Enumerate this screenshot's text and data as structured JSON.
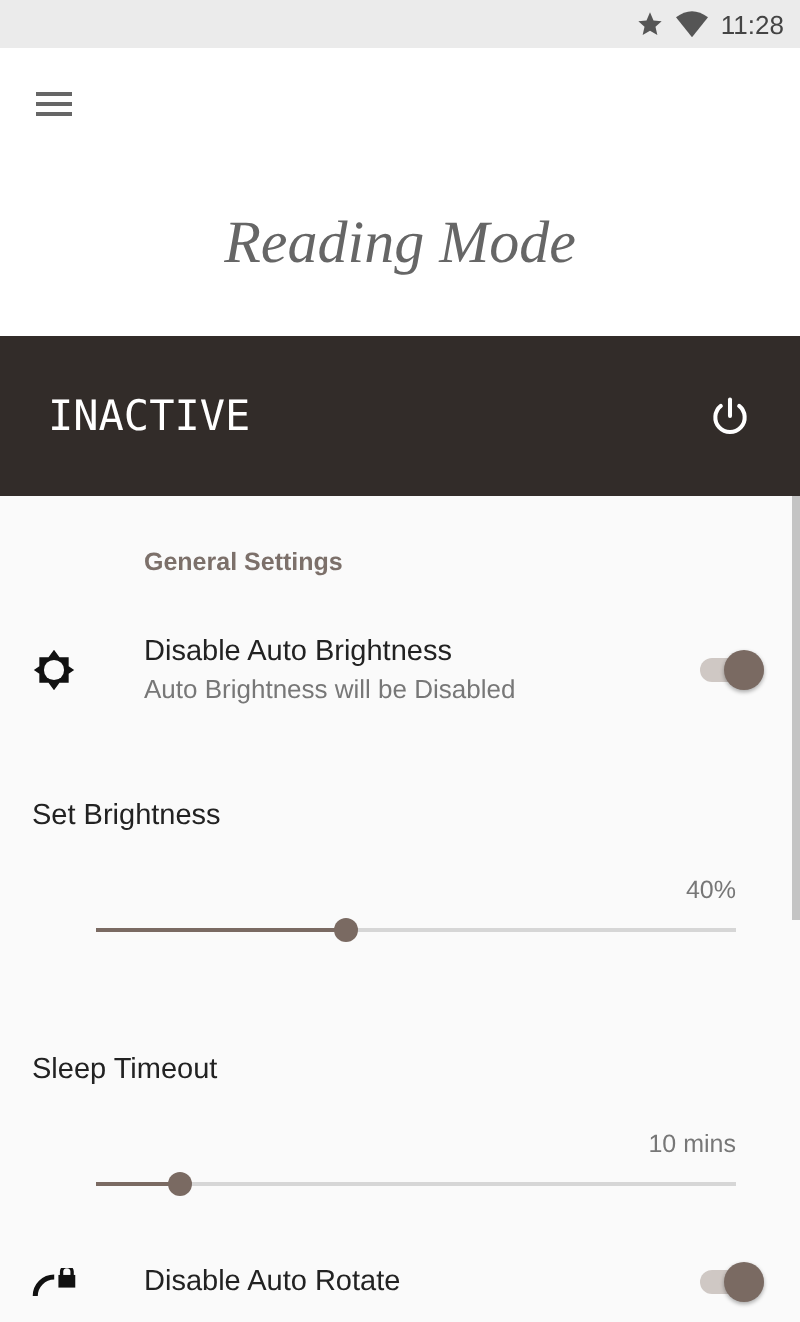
{
  "status_bar": {
    "time": "11:28"
  },
  "app_bar": {
    "title": "Reading Mode"
  },
  "mode_bar": {
    "status": "INACTIVE"
  },
  "section": {
    "title": "General Settings"
  },
  "settings": [
    {
      "kind": "switch",
      "title": "Disable Auto Brightness",
      "summary": "Auto Brightness will be Disabled",
      "on": true
    },
    {
      "kind": "slider",
      "title": "Set Brightness",
      "reading": "40%",
      "level": 0.39
    },
    {
      "kind": "slider",
      "title": "Sleep Timeout",
      "reading": "10 mins",
      "level": 0.13
    },
    {
      "kind": "switch",
      "title": "Disable Auto Rotate",
      "on": true
    }
  ]
}
